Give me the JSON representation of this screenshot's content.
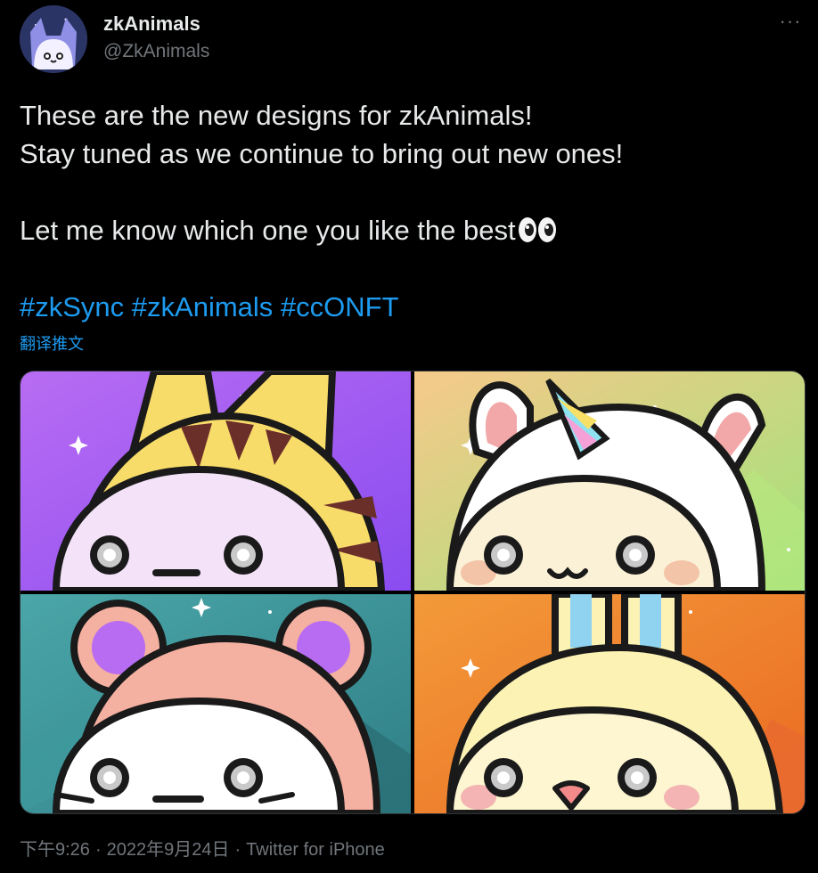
{
  "author": {
    "name": "zkAnimals",
    "handle": "@ZkAnimals"
  },
  "more_label": "···",
  "tweet": {
    "line1": "These are the new designs for zkAnimals!",
    "line2": "Stay tuned as we continue to bring out new ones!",
    "line3": "Let me know which one you like the best",
    "emoji": "eyes-emoji",
    "hashtags": [
      "#zkSync",
      "#zkAnimals",
      "#ccONFT"
    ],
    "translate_label": "翻译推文"
  },
  "media": {
    "images": [
      {
        "name": "tiger-character",
        "bg_from": "#b86cf2",
        "bg_to": "#8a4cf0"
      },
      {
        "name": "unicorn-character",
        "bg_from": "#f6c98a",
        "bg_to": "#9fe37a"
      },
      {
        "name": "bear-character",
        "bg_from": "#4aa6a8",
        "bg_to": "#2f7f86"
      },
      {
        "name": "bunny-character",
        "bg_from": "#f39a3a",
        "bg_to": "#ea6a22"
      }
    ]
  },
  "meta": {
    "time": "下午9:26",
    "date": "2022年9月24日",
    "source": "Twitter for iPhone",
    "separator": "·"
  },
  "colors": {
    "background": "#000000",
    "text": "#e7e9ea",
    "secondary": "#71767b",
    "link": "#1d9bf0"
  }
}
